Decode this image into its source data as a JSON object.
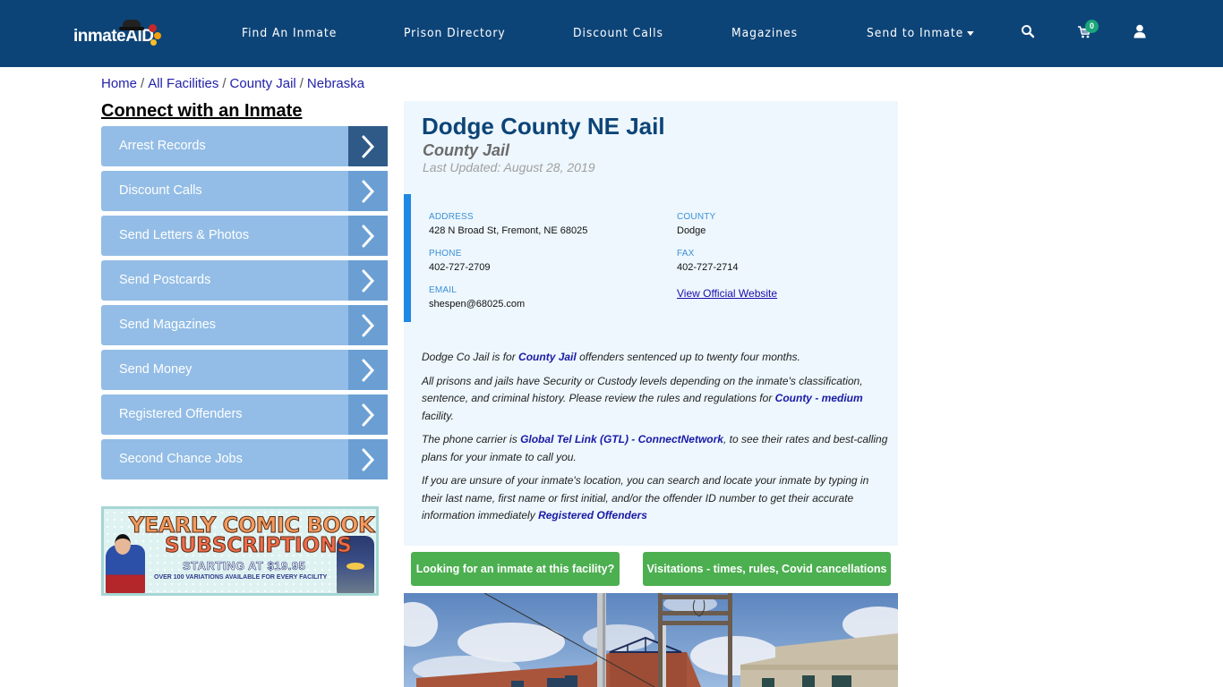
{
  "header": {
    "logo": {
      "text": "inmateAID",
      "icon": "inmateaid-logo-icon"
    },
    "nav": [
      {
        "label": "Find An Inmate"
      },
      {
        "label": "Prison Directory"
      },
      {
        "label": "Discount Calls"
      },
      {
        "label": "Magazines"
      },
      {
        "label": "Send to Inmate",
        "has_dropdown": true
      }
    ],
    "icons": {
      "search": "search-icon",
      "cart": "cart-icon",
      "user": "user-icon"
    },
    "cart_count": "0",
    "colors": {
      "background": "#0d4478",
      "badge": "#1aa57a"
    }
  },
  "breadcrumb": {
    "items": [
      "Home",
      "All Facilities",
      "County Jail",
      "Nebraska"
    ],
    "separator": "/"
  },
  "sidebar": {
    "title": "Connect with an Inmate",
    "items": [
      {
        "label": "Arrest Records",
        "active": true
      },
      {
        "label": "Discount Calls"
      },
      {
        "label": "Send Letters & Photos"
      },
      {
        "label": "Send Postcards"
      },
      {
        "label": "Send Magazines"
      },
      {
        "label": "Send Money"
      },
      {
        "label": "Registered Offenders"
      },
      {
        "label": "Second Chance Jobs"
      }
    ],
    "ad": {
      "line1": "YEARLY COMIC BOOK",
      "line2": "SUBSCRIPTIONS",
      "line3": "STARTING AT $19.95",
      "line4": "OVER 100 VARIATIONS AVAILABLE FOR EVERY FACILITY"
    }
  },
  "facility": {
    "name": "Dodge County NE Jail",
    "type": "County Jail",
    "last_updated": "Last Updated: August 28, 2019",
    "info": {
      "address_label": "ADDRESS",
      "address": "428 N Broad St, Fremont, NE 68025",
      "county_label": "COUNTY",
      "county": "Dodge",
      "phone_label": "PHONE",
      "phone": "402-727-2709",
      "fax_label": "FAX",
      "fax": "402-727-2714",
      "email_label": "EMAIL",
      "email": "shespen@68025.com",
      "website_link": "View Official Website"
    },
    "description": {
      "p1": {
        "pre": "Dodge Co Jail is for ",
        "link": "County Jail",
        "post": " offenders sentenced up to twenty four months."
      },
      "p2": {
        "pre": "All prisons and jails have Security or Custody levels depending on the inmate's classification, sentence, and criminal history. Please review the rules and regulations for ",
        "link": "County - medium",
        "post": " facility."
      },
      "p3": {
        "pre": "The phone carrier is ",
        "link": "Global Tel Link (GTL) - ConnectNetwork",
        "post": ", to see their rates and best-calling plans for your inmate to call you."
      },
      "p4": {
        "pre": "If you are unsure of your inmate's location, you can search and locate your inmate by typing in their last name, first name or first initial, and/or the offender ID number to get their accurate information immediately ",
        "link": "Registered Offenders",
        "post": ""
      }
    },
    "buttons": {
      "find_inmate": "Looking for an inmate at this facility?",
      "visitation": "Visitations - times, rules, Covid cancellations"
    },
    "photo": "facility-street-photo"
  }
}
